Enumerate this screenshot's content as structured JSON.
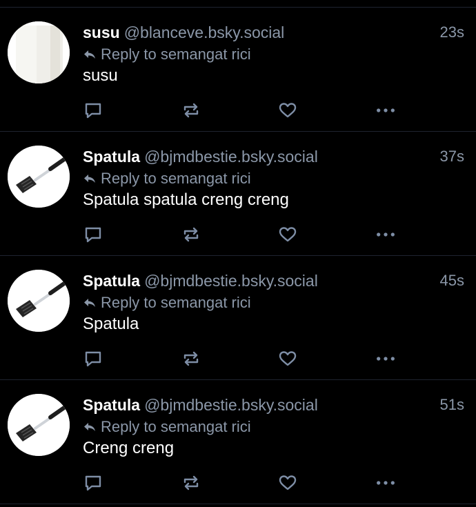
{
  "colors": {
    "background": "#000000",
    "text": "#ffffff",
    "muted": "#8b97a8",
    "icon": "#7e8ea6",
    "divider": "#1f2430"
  },
  "posts": [
    {
      "display_name": "susu",
      "handle": "@blanceve.bsky.social",
      "time": "23s",
      "reply_label": "Reply to semangat rici",
      "text": "susu",
      "avatar": "cup-avatar"
    },
    {
      "display_name": "Spatula",
      "handle": "@bjmdbestie.bsky.social",
      "time": "37s",
      "reply_label": "Reply to semangat rici",
      "text": "Spatula spatula creng creng",
      "avatar": "spatula-avatar"
    },
    {
      "display_name": "Spatula",
      "handle": "@bjmdbestie.bsky.social",
      "time": "45s",
      "reply_label": "Reply to semangat rici",
      "text": "Spatula",
      "avatar": "spatula-avatar"
    },
    {
      "display_name": "Spatula",
      "handle": "@bjmdbestie.bsky.social",
      "time": "51s",
      "reply_label": "Reply to semangat rici",
      "text": "Creng creng",
      "avatar": "spatula-avatar"
    }
  ],
  "icons": {
    "reply": "reply-icon",
    "repost": "repost-icon",
    "like": "heart-icon",
    "more": "more-options-icon",
    "reply_to": "reply-arrow-icon"
  }
}
